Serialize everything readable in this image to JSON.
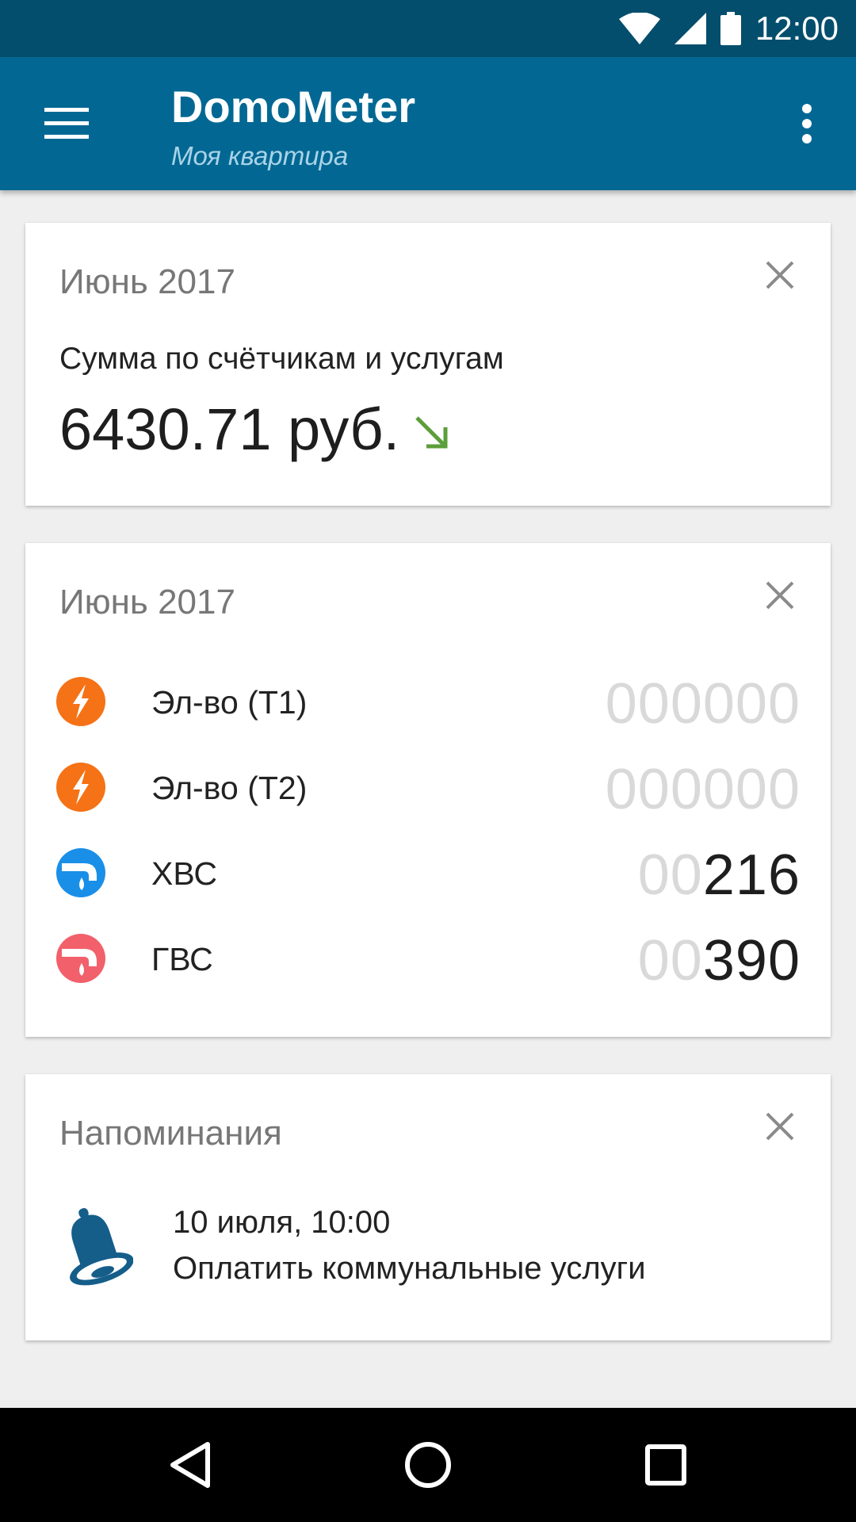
{
  "status_bar": {
    "time": "12:00",
    "icons": [
      "wifi-icon",
      "cell-signal-icon",
      "battery-icon"
    ]
  },
  "app_bar": {
    "title": "DomoMeter",
    "subtitle": "Моя квартира",
    "icons": [
      "menu-icon",
      "overflow-menu-icon"
    ]
  },
  "colors": {
    "status_bar": "#044e6d",
    "app_bar": "#026893",
    "background": "#efefef",
    "electricity": "#f57216",
    "cold_water": "#1a8fe8",
    "hot_water": "#f2606b",
    "trend_down": "#5b9e3a",
    "bell": "#155e8a"
  },
  "cards": {
    "summary": {
      "title": "Июнь 2017",
      "label": "Сумма по счётчикам и услугам",
      "amount": "6430.71 руб.",
      "trend_icon": "arrow-down-right-icon"
    },
    "meters": {
      "title": "Июнь 2017",
      "rows": [
        {
          "label": "Эл-во (Т1)",
          "lead": "000000",
          "digits": "",
          "icon": "electricity-icon"
        },
        {
          "label": "Эл-во (Т2)",
          "lead": "000000",
          "digits": "",
          "icon": "electricity-icon"
        },
        {
          "label": "ХВС",
          "lead": "00",
          "digits": "216",
          "icon": "cold-water-icon"
        },
        {
          "label": "ГВС",
          "lead": "00",
          "digits": "390",
          "icon": "hot-water-icon"
        }
      ]
    },
    "reminders": {
      "title": "Напоминания",
      "date": "10 июля, 10:00",
      "text": "Оплатить коммунальные услуги",
      "icon": "bell-icon"
    }
  },
  "nav_bar": {
    "icons": [
      "back-icon",
      "home-icon",
      "recents-icon"
    ]
  }
}
